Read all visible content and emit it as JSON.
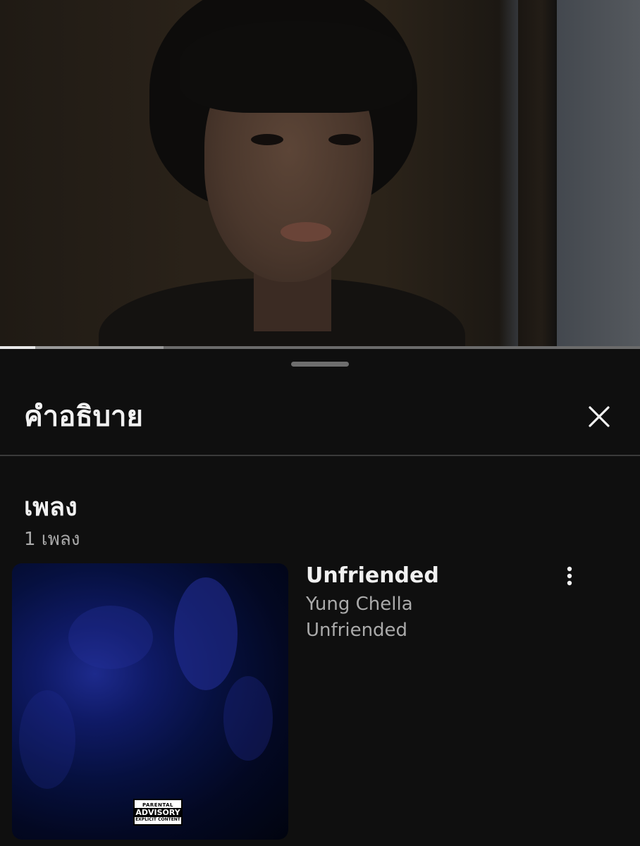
{
  "video": {
    "progress_played_fraction": 0.055,
    "progress_buffered_fraction": 0.255
  },
  "sheet": {
    "title": "คำอธิบาย",
    "close_icon": "close-icon"
  },
  "music_section": {
    "title": "เพลง",
    "count": "1 เพลง",
    "songs": [
      {
        "title": "Unfriended",
        "artist": "Yung Chella",
        "album": "Unfriended",
        "more_icon": "more-vert-icon",
        "advisory": {
          "line1": "PARENTAL",
          "line2": "ADVISORY",
          "line3": "EXPLICIT CONTENT"
        }
      }
    ]
  },
  "colors": {
    "background": "#0f0f0f",
    "primary_text": "#f1f1f1",
    "secondary_text": "#aaaaaa",
    "divider": "#3a3a3a"
  }
}
